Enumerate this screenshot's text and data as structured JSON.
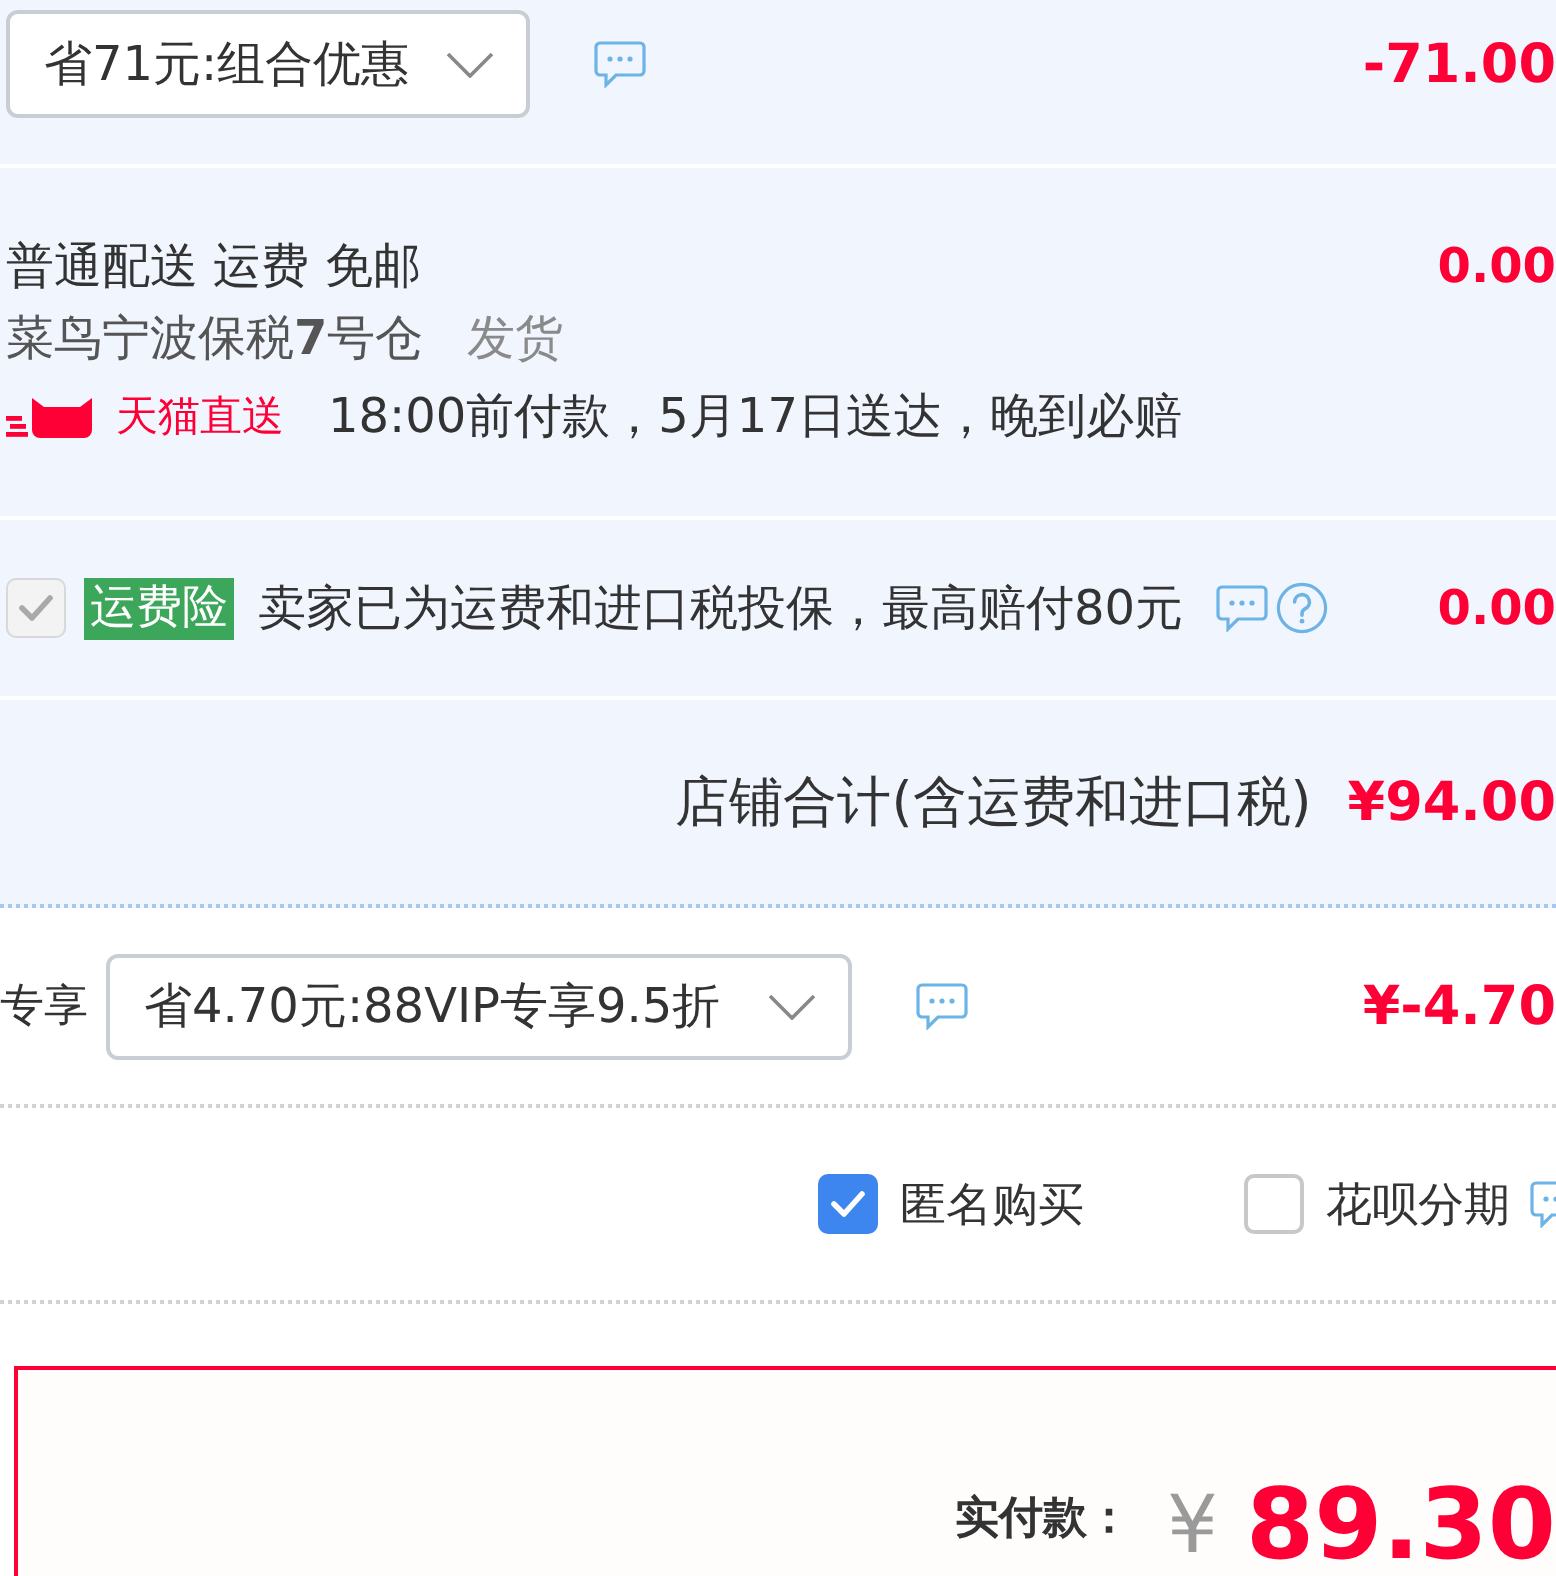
{
  "discount_row": {
    "dropdown": "省71元:组合优惠",
    "amount": "-71.00"
  },
  "delivery": {
    "method": "普通配送 运费 免邮",
    "amount": "0.00",
    "warehouse": "菜鸟宁波保税**7**号仓",
    "ship_label": "发货",
    "badge": "天猫直送",
    "promise": "18:00前付款，5月17日送达，晚到必赔"
  },
  "insurance": {
    "checked": true,
    "disabled": true,
    "tag": "运费险",
    "text": "卖家已为运费和进口税投保，最高赔付80元",
    "amount": "0.00"
  },
  "shop_total": {
    "label": "店铺合计(含运费和进口税)",
    "amount": "¥94.00"
  },
  "vip_row": {
    "label": "专享",
    "dropdown": "省4.70元:88VIP专享9.5折",
    "amount": "¥-4.70"
  },
  "options": [
    {
      "label": "匿名购买",
      "checked": true
    },
    {
      "label": "花呗分期",
      "checked": false
    }
  ],
  "payment": {
    "label": "实付款：",
    "currency": "¥",
    "amount": "89.30"
  }
}
